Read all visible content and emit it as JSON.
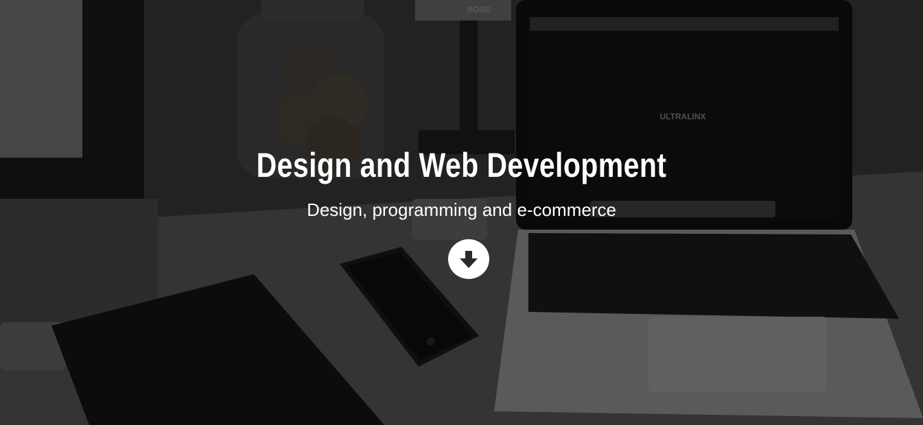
{
  "hero": {
    "title": "Design and Web Development",
    "subtitle": "Design, programming and e-commerce",
    "scroll_icon": "arrow-down-circle-icon",
    "laptop_screen_text": "ULTRALINX",
    "speaker_brand": "BOSE"
  },
  "colors": {
    "text": "#ffffff",
    "button_bg": "#ffffff",
    "icon": "#2b2b2b"
  }
}
